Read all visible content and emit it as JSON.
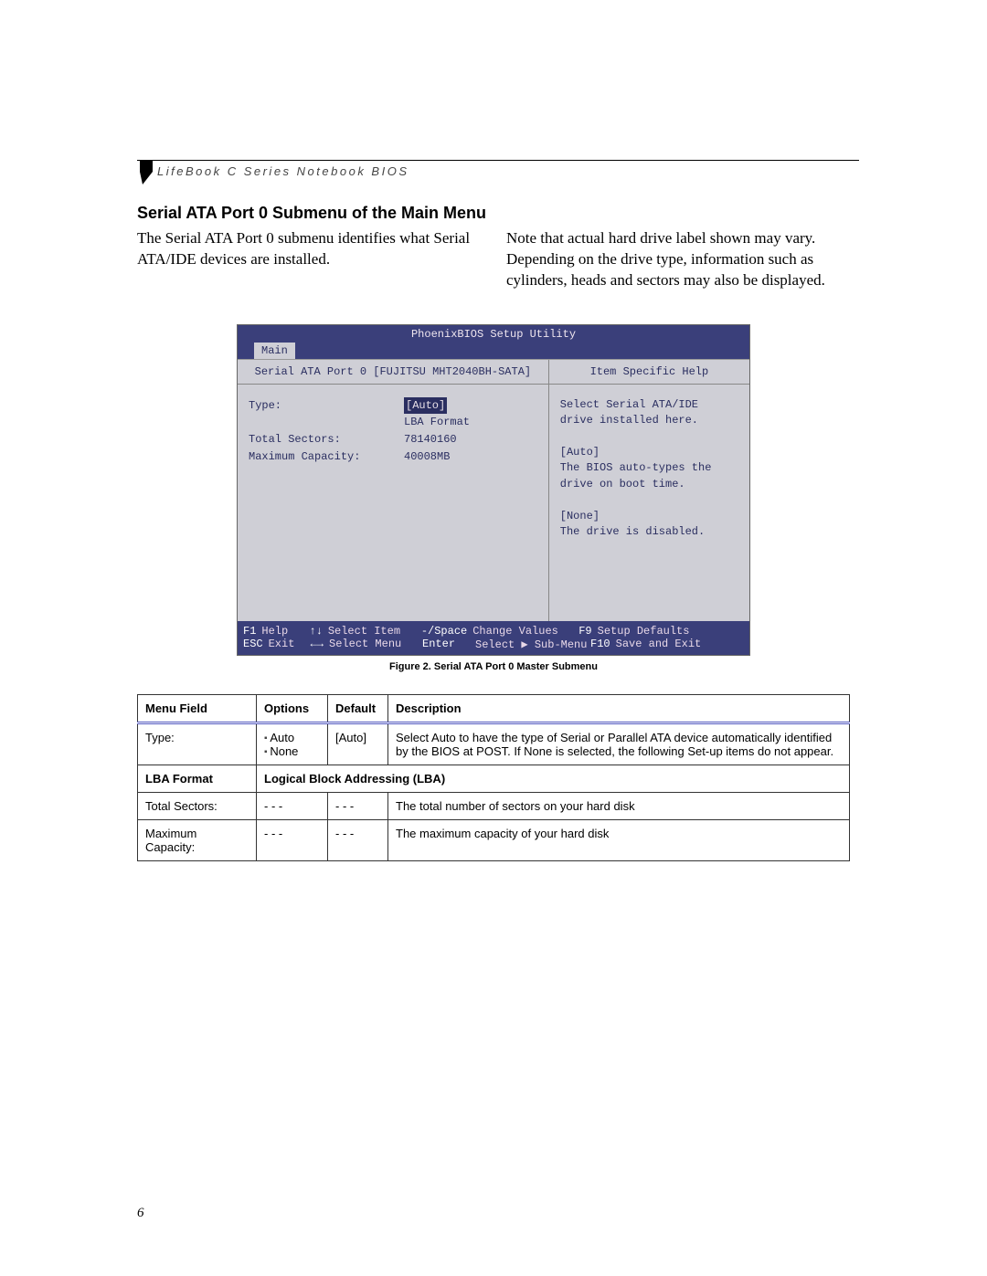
{
  "running_header": "LifeBook C Series Notebook BIOS",
  "section_title": "Serial ATA Port 0 Submenu of the Main Menu",
  "para_left": "The Serial ATA Port 0 submenu identifies what Serial ATA/IDE devices are installed.",
  "para_right": "Note that actual hard drive label shown may vary. Depending on the drive type, information such as cylinders, heads and sectors may also be displayed.",
  "bios": {
    "app_title": "PhoenixBIOS Setup Utility",
    "tab": "Main",
    "left_title": "Serial ATA Port 0 [FUJITSU MHT2040BH-SATA]",
    "right_title": "Item Specific Help",
    "rows": {
      "type_label": "Type:",
      "type_value": "[Auto]",
      "lba_label": "",
      "lba_value": "LBA Format",
      "sectors_label": "Total Sectors:",
      "sectors_value": "78140160",
      "capacity_label": "Maximum Capacity:",
      "capacity_value": "40008MB"
    },
    "help_text": "Select Serial ATA/IDE\ndrive installed here.\n\n[Auto]\nThe BIOS auto-types the\ndrive on boot time.\n\n[None]\nThe drive is disabled.",
    "foot": {
      "r1a": "F1",
      "r1b": "Help",
      "r1c": "↑↓",
      "r1d": "Select Item",
      "r1e": "-/Space",
      "r1f": "Change Values",
      "r1g": "F9",
      "r1h": "Setup Defaults",
      "r2a": "ESC",
      "r2b": "Exit",
      "r2c": "←→",
      "r2d": "Select Menu",
      "r2e": "Enter",
      "r2f": "Select ▶ Sub-Menu",
      "r2g": "F10",
      "r2h": "Save and Exit"
    }
  },
  "figure_caption": "Figure 2.  Serial ATA Port 0 Master Submenu",
  "table": {
    "headers": {
      "c1": "Menu Field",
      "c2": "Options",
      "c3": "Default",
      "c4": "Description"
    },
    "rows": [
      {
        "field": "Type:",
        "options": [
          "Auto",
          "None"
        ],
        "default": "[Auto]",
        "desc": "Select Auto to have the type of Serial or Parallel ATA device automatically identified by the BIOS at POST. If None is selected, the following Set-up items do not appear."
      },
      {
        "field": "LBA Format",
        "options_text": "",
        "default": "",
        "desc": "Logical Block Addressing (LBA)",
        "bold_row": true
      },
      {
        "field": "Total Sectors:",
        "options_text": "- - -",
        "default": "- - -",
        "desc": "The total number of sectors on your hard disk"
      },
      {
        "field": "Maximum Capacity:",
        "options_text": "- - -",
        "default": "- - -",
        "desc": "The maximum capacity of your hard disk"
      }
    ]
  },
  "page_number": "6"
}
